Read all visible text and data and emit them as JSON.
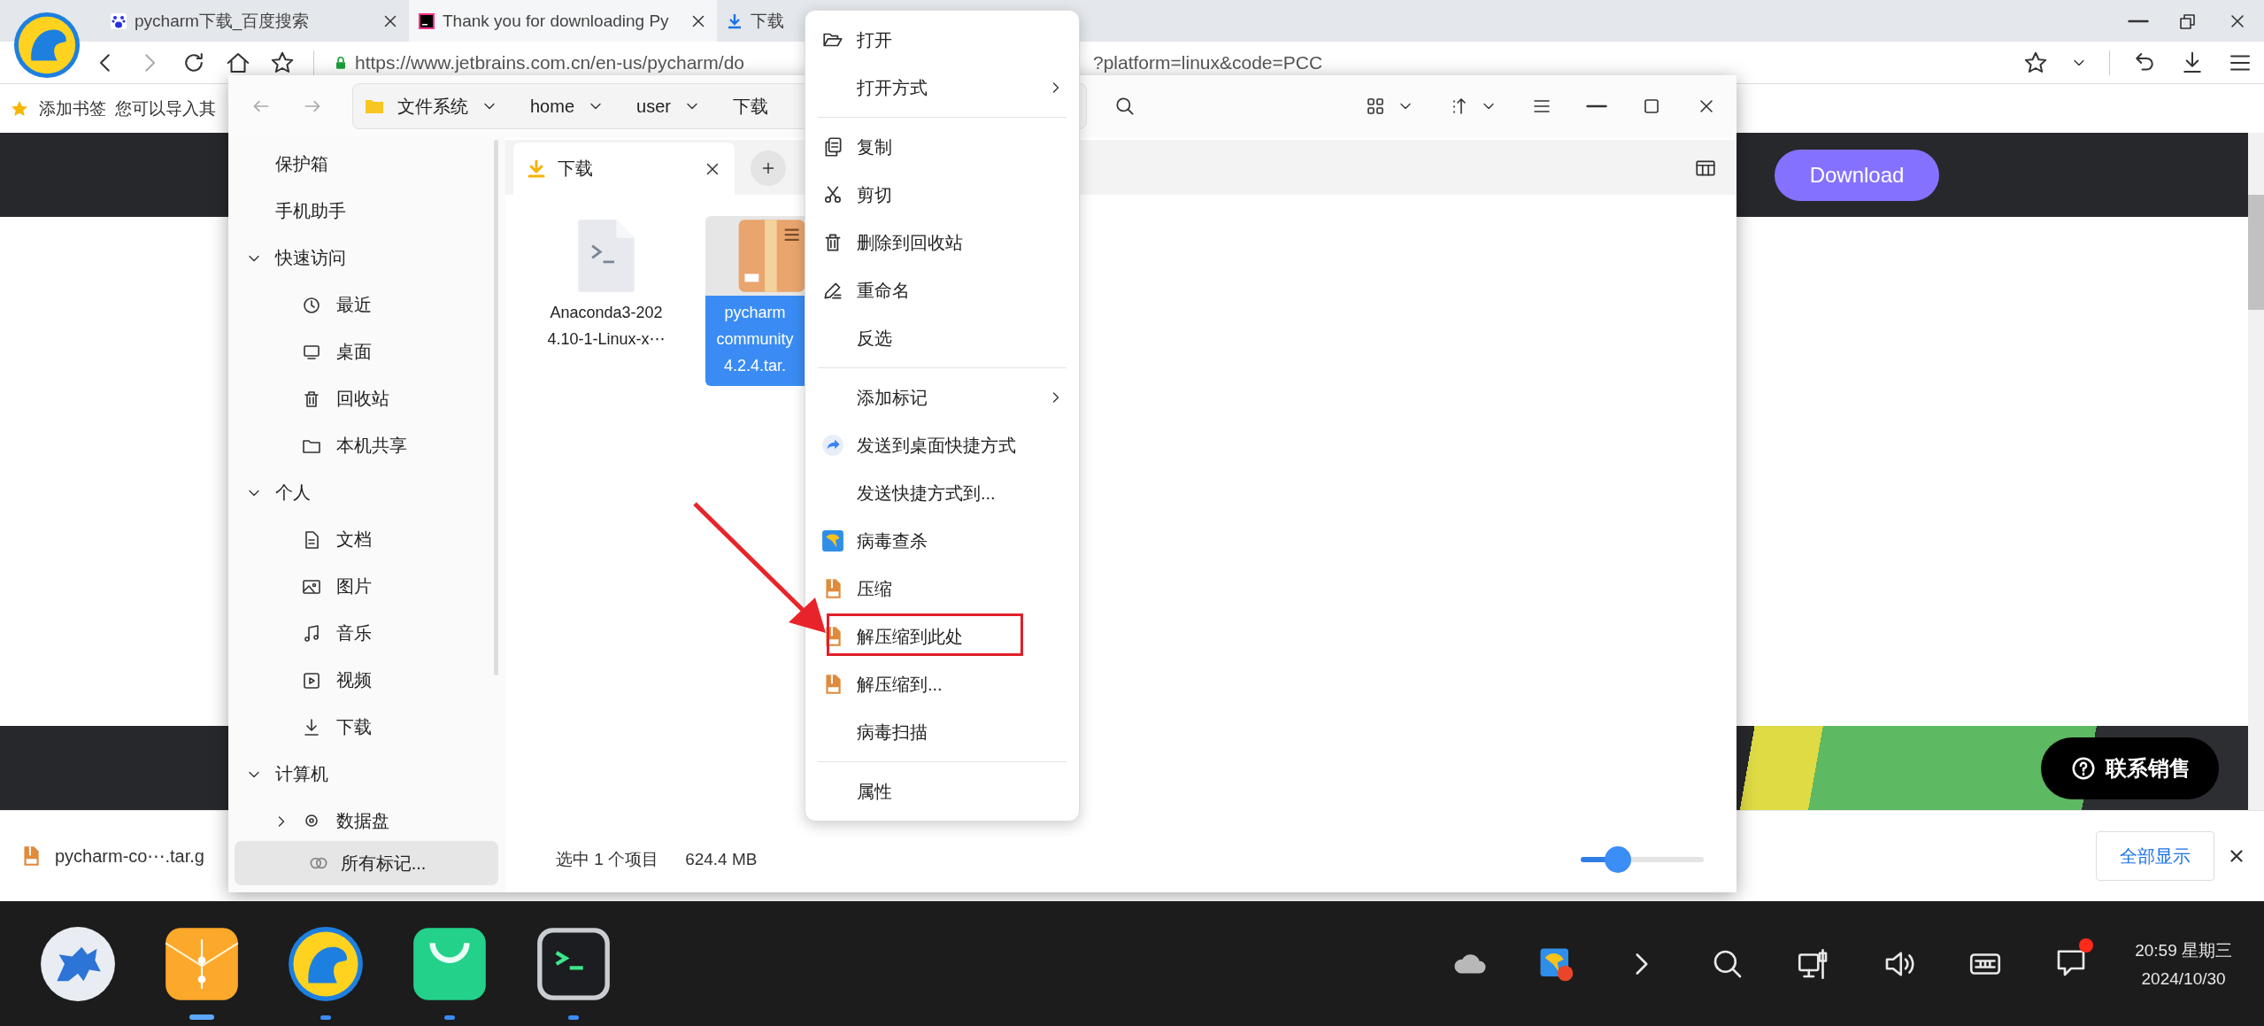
{
  "browser": {
    "tabs": [
      {
        "title": "pycharm下载_百度搜索",
        "kind": "search",
        "selected": false
      },
      {
        "title": "Thank you for downloading Py",
        "kind": "site",
        "selected": true
      },
      {
        "title": "下载",
        "kind": "download",
        "selected": false
      }
    ],
    "url_start": "https://www.jetbrains.com.cn/en-us/pycharm/do",
    "url_end": "?platform=linux&code=PCC",
    "bookmarks": [
      "添加书签",
      "您可以导入其"
    ],
    "page": {
      "download_button": "Download",
      "contact_button": "联系销售"
    },
    "download_bar": {
      "file": "pycharm-co⋯.tar.g",
      "show_all": "全部显示"
    }
  },
  "file_manager": {
    "breadcrumb": [
      "文件系统",
      "home",
      "user",
      "下载"
    ],
    "sidebar": {
      "items": [
        {
          "label": "保护箱"
        },
        {
          "label": "手机助手"
        },
        {
          "label": "快速访问",
          "expanded": true,
          "children": [
            {
              "label": "最近"
            },
            {
              "label": "桌面"
            },
            {
              "label": "回收站"
            },
            {
              "label": "本机共享"
            }
          ]
        },
        {
          "label": "个人",
          "expanded": true,
          "children": [
            {
              "label": "文档"
            },
            {
              "label": "图片"
            },
            {
              "label": "音乐"
            },
            {
              "label": "视频"
            },
            {
              "label": "下载"
            }
          ]
        },
        {
          "label": "计算机",
          "expanded": true,
          "children": [
            {
              "label": "数据盘",
              "expanded": false
            }
          ]
        }
      ],
      "tags_button": "所有标记..."
    },
    "tab": "下载",
    "files": [
      {
        "kind": "script",
        "lines": [
          "Anaconda3-202",
          "4.10-1-Linux-x⋯"
        ],
        "selected": false
      },
      {
        "kind": "archive",
        "lines": [
          "pycharm",
          "community",
          "4.2.4.tar."
        ],
        "selected": true
      }
    ],
    "status": [
      "选中 1 个项目",
      "624.4 MB"
    ],
    "zoom": {
      "level": 0.3
    }
  },
  "context_menu": [
    {
      "label": "打开",
      "kind": "action",
      "highlighted": false
    },
    {
      "label": "打开方式",
      "kind": "submenu",
      "highlighted": false
    },
    {
      "kind": "separator"
    },
    {
      "label": "复制",
      "kind": "action",
      "highlighted": false
    },
    {
      "label": "剪切",
      "kind": "action",
      "highlighted": false
    },
    {
      "label": "删除到回收站",
      "kind": "action",
      "highlighted": false
    },
    {
      "label": "重命名",
      "kind": "action",
      "highlighted": false
    },
    {
      "label": "反选",
      "kind": "action",
      "highlighted": false
    },
    {
      "kind": "separator"
    },
    {
      "label": "添加标记",
      "kind": "submenu",
      "highlighted": false
    },
    {
      "label": "发送到桌面快捷方式",
      "kind": "action",
      "highlighted": false
    },
    {
      "label": "发送快捷方式到...",
      "kind": "action",
      "highlighted": false
    },
    {
      "label": "病毒查杀",
      "kind": "action",
      "highlighted": false
    },
    {
      "label": "压缩",
      "kind": "action",
      "highlighted": false
    },
    {
      "label": "解压缩到此处",
      "kind": "action",
      "highlighted": true
    },
    {
      "label": "解压缩到...",
      "kind": "action",
      "highlighted": false
    },
    {
      "label": "病毒扫描",
      "kind": "action",
      "highlighted": false
    },
    {
      "kind": "separator"
    },
    {
      "label": "属性",
      "kind": "action",
      "highlighted": false
    }
  ],
  "taskbar": {
    "apps": [
      {
        "running": false,
        "focused": false
      },
      {
        "running": true,
        "focused": true
      },
      {
        "running": true,
        "focused": false
      },
      {
        "running": true,
        "focused": false
      },
      {
        "running": true,
        "focused": false
      }
    ],
    "notification_badge": true,
    "clock_time": "20:59 星期三",
    "clock_date": "2024/10/30"
  }
}
